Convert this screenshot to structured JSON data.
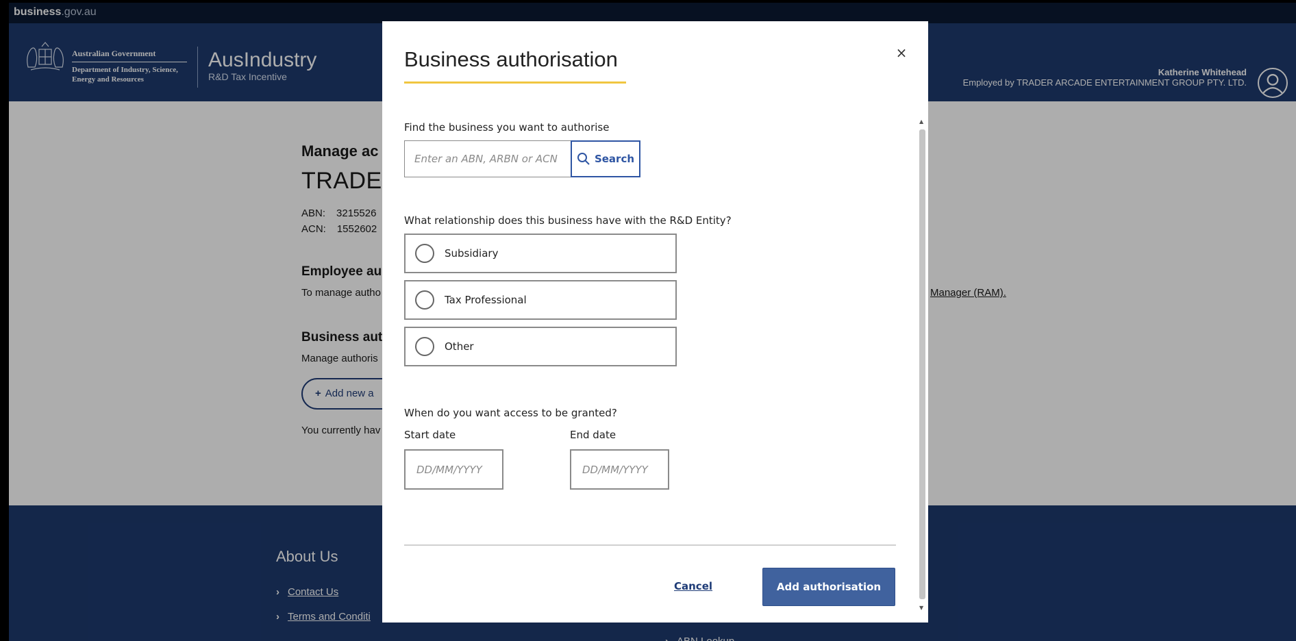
{
  "topbar": {
    "brand_bold": "business",
    "brand_rest": ".gov.au"
  },
  "header": {
    "gov_line1": "Australian Government",
    "gov_line2": "Department of Industry, Science,",
    "gov_line3": "Energy and Resources",
    "app_title": "AusIndustry",
    "app_subtitle": "R&D Tax Incentive",
    "user_name": "Katherine Whitehead",
    "user_employer": "Employed by TRADER ARCADE ENTERTAINMENT GROUP PTY. LTD."
  },
  "main": {
    "manage_label": "Manage ac",
    "company_name": "TRADER",
    "abn_label": "ABN:",
    "abn_value": "3215526",
    "acn_label": "ACN:",
    "acn_value": "1552602",
    "employee_auth_heading": "Employee au",
    "manage_text": "To manage autho",
    "ram_link": "Manager (RAM)",
    "ram_suffix": ".",
    "business_auth_heading": "Business auth",
    "manage_auth_text": "Manage authoris",
    "add_new_label": "Add new a",
    "current_text": "You currently hav"
  },
  "footer": {
    "about_heading": "About Us",
    "links": [
      "Contact Us",
      "Terms and Conditi",
      "ABN Lookup"
    ]
  },
  "modal": {
    "title": "Business authorisation",
    "close_symbol": "×",
    "find_label": "Find the business you want to authorise",
    "search_placeholder": "Enter an ABN, ARBN or ACN",
    "search_button": "Search",
    "relationship_label": "What relationship does this business have with the R&D Entity?",
    "relationship_options": [
      "Subsidiary",
      "Tax Professional",
      "Other"
    ],
    "when_label": "When do you want access to be granted?",
    "start_label": "Start date",
    "end_label": "End date",
    "date_placeholder": "DD/MM/YYYY",
    "cancel_label": "Cancel",
    "submit_label": "Add authorisation"
  },
  "colors": {
    "header_bg": "#1e3a6e",
    "topbar_bg": "#0b1a33",
    "accent_underline": "#f0c640",
    "primary_button": "#40629e",
    "link": "#1f3c77"
  }
}
